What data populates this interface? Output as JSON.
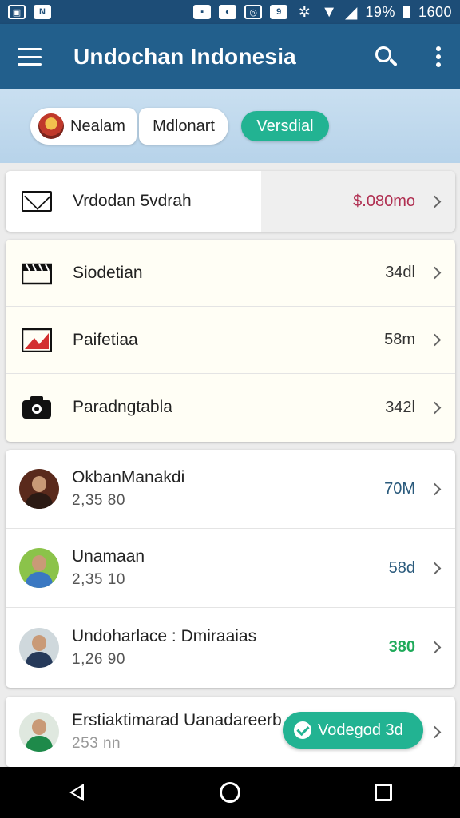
{
  "status_bar": {
    "battery": "19%",
    "time": "1600",
    "icons": [
      "photo-icon",
      "app-icon",
      "notification-icon",
      "sync-icon",
      "alarm-icon",
      "nfc-icon",
      "settings-icon",
      "wifi-icon",
      "signal-icon",
      "battery-icon"
    ]
  },
  "app_bar": {
    "title": "Undochan Indonesia"
  },
  "filters": {
    "chip_1": "Nealam",
    "chip_2": "Mdlonart",
    "chip_3": "Versdial"
  },
  "primary_row": {
    "label": "Vrdodan 5vdrah",
    "value": "$.080mo",
    "icon": "mail-icon"
  },
  "categories": [
    {
      "label": "Siodetian",
      "value": "34dl",
      "icon": "clapper-icon"
    },
    {
      "label": "Paifetiaa",
      "value": "58m",
      "icon": "image-icon"
    },
    {
      "label": "Paradngtabla",
      "value": "342l",
      "icon": "camera-icon"
    }
  ],
  "people": [
    {
      "name": "OkbanManakdi",
      "sub": "2,35 80",
      "value": "70M"
    },
    {
      "name": "Unamaan",
      "sub": "2,35 10",
      "value": "58d"
    },
    {
      "name": "Undoharlace : Dmiraaias",
      "sub": "1,26 90",
      "value": "380"
    },
    {
      "name": "Erstiaktimarad Uanadareerb",
      "sub": "253 nn",
      "value": ""
    }
  ],
  "badge": {
    "label": "Vodegod 3d"
  },
  "colors": {
    "app_bar": "#225f8c",
    "accent": "#22b392",
    "price": "#b03052",
    "green_value": "#1faa5a"
  },
  "nav": {
    "icons": [
      "back-icon",
      "home-icon",
      "recent-apps-icon"
    ]
  }
}
